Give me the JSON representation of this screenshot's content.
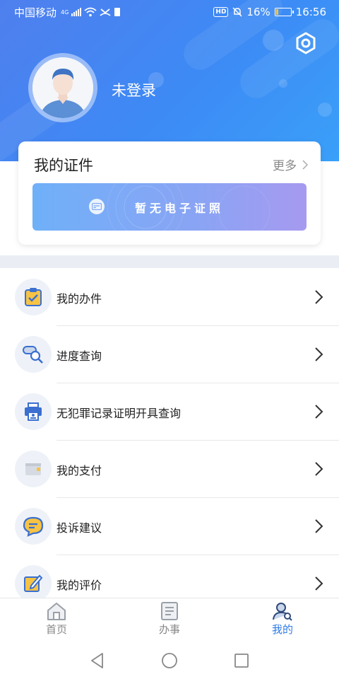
{
  "status_bar": {
    "carrier": "中国移动",
    "network": "4G",
    "battery_percent": "16%",
    "time": "16:56",
    "battery_level": 0.16
  },
  "profile": {
    "login_label": "未登录",
    "settings_icon": "gear-icon"
  },
  "certificates": {
    "title": "我的证件",
    "more_label": "更多",
    "empty_label": "暂无电子证照"
  },
  "menu": [
    {
      "label": "我的办件",
      "icon": "clipboard-check-icon"
    },
    {
      "label": "进度查询",
      "icon": "search-progress-icon"
    },
    {
      "label": "无犯罪记录证明开具查询",
      "icon": "printer-icon"
    },
    {
      "label": "我的支付",
      "icon": "wallet-icon"
    },
    {
      "label": "投诉建议",
      "icon": "chat-bubble-icon"
    },
    {
      "label": "我的评价",
      "icon": "edit-icon"
    }
  ],
  "bottom_nav": [
    {
      "label": "首页",
      "icon": "home-icon",
      "active": false
    },
    {
      "label": "办事",
      "icon": "document-icon",
      "active": false
    },
    {
      "label": "我的",
      "icon": "user-search-icon",
      "active": true
    }
  ],
  "colors": {
    "header_gradient_start": "#4f7fee",
    "header_gradient_end": "#3aa0f8",
    "accent": "#2f7be6",
    "banner_start": "#6fb0f8",
    "banner_end": "#a69af0"
  }
}
